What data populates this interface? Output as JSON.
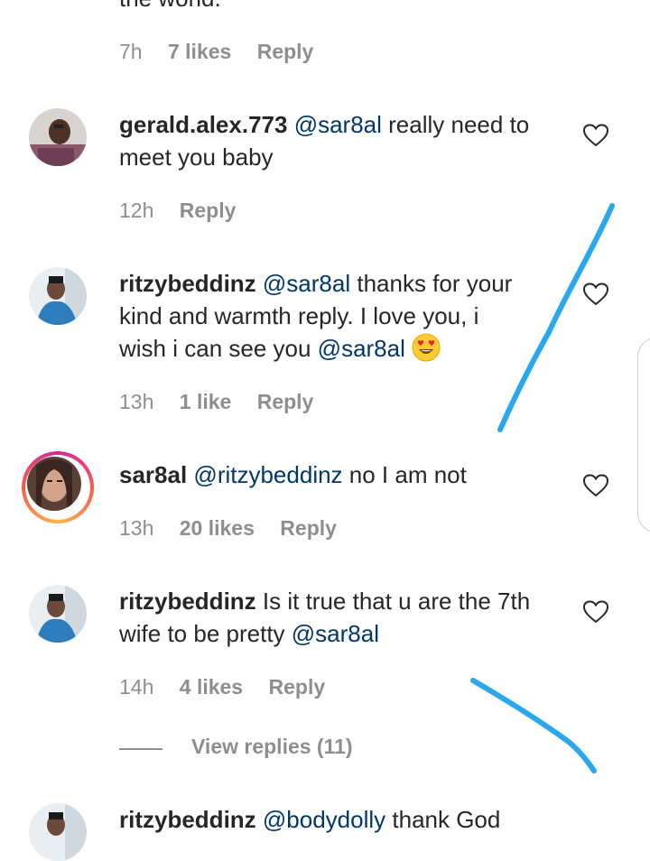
{
  "top_comment": {
    "text_tail": "the world.",
    "time": "7h",
    "likes": "7 likes",
    "reply": "Reply"
  },
  "comments": [
    {
      "username": "gerald.alex.773",
      "mention": "@sar8al",
      "text_a": " really need to",
      "text_b": "meet you baby",
      "time": "12h",
      "likes": "",
      "reply": "Reply"
    },
    {
      "username": "ritzybeddinz",
      "mention": "@sar8al",
      "text_a": " thanks for your",
      "text_b": "kind and warmth reply. I love you, i",
      "text_c": "wish i can see you ",
      "mention2": "@sar8al",
      "time": "13h",
      "likes": "1 like",
      "reply": "Reply"
    },
    {
      "username": "sar8al",
      "mention": "@ritzybeddinz",
      "text_a": " no I am not",
      "time": "13h",
      "likes": "20 likes",
      "reply": "Reply"
    },
    {
      "username": "ritzybeddinz",
      "text_a": " Is it true that u are the 7th",
      "text_b": "wife to be pretty ",
      "mention": "@sar8al",
      "time": "14h",
      "likes": "4 likes",
      "reply": "Reply"
    }
  ],
  "view_replies": "View replies (11)",
  "bottom_comment": {
    "username": "ritzybeddinz",
    "mention": "@bodydolly",
    "text": " thank God"
  },
  "colors": {
    "mention": "#00376b",
    "meta": "#8e8e8e",
    "scribble": "#29a8f0"
  },
  "icons": {
    "like": "heart-outline-icon",
    "emoji": "heart-eyes-emoji-icon"
  }
}
